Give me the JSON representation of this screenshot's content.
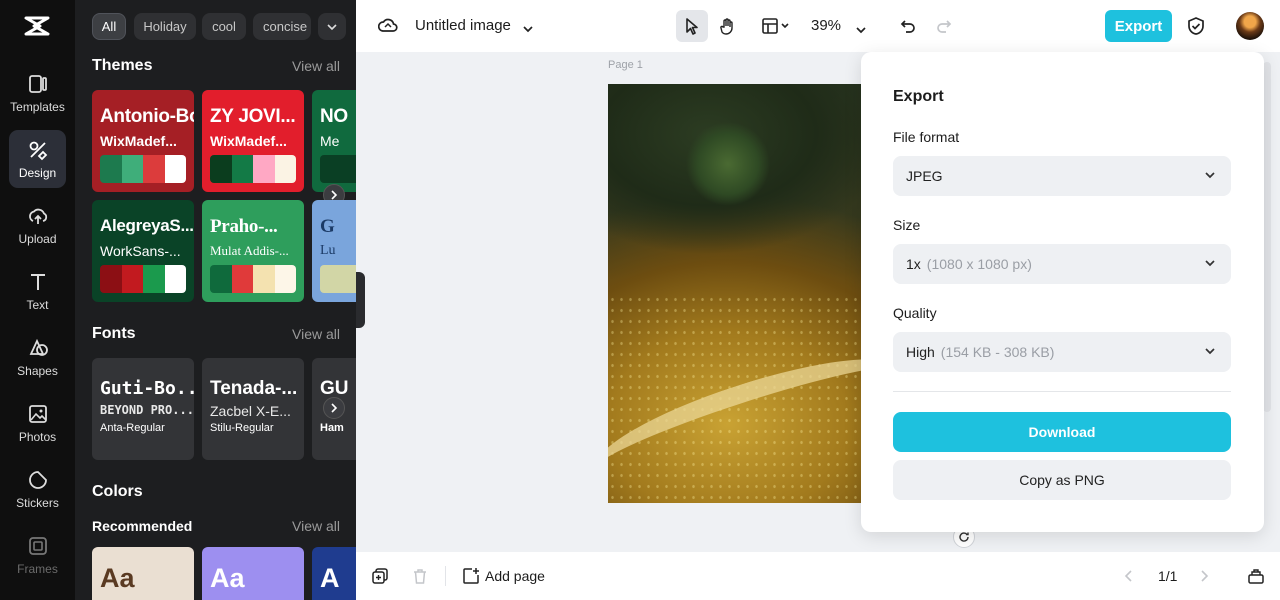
{
  "rail": {
    "items": [
      {
        "label": "Templates",
        "icon": "templates-icon"
      },
      {
        "label": "Design",
        "icon": "design-icon"
      },
      {
        "label": "Upload",
        "icon": "upload-icon"
      },
      {
        "label": "Text",
        "icon": "text-icon"
      },
      {
        "label": "Shapes",
        "icon": "shapes-icon"
      },
      {
        "label": "Photos",
        "icon": "photos-icon"
      },
      {
        "label": "Stickers",
        "icon": "stickers-icon"
      },
      {
        "label": "Frames",
        "icon": "frames-icon"
      }
    ]
  },
  "panel": {
    "chips": [
      "All",
      "Holiday",
      "cool",
      "concise"
    ],
    "themes": {
      "title": "Themes",
      "view_all": "View all",
      "cards": [
        {
          "font1": "Antonio-Bold",
          "font2": "WixMadef..."
        },
        {
          "font1": "ZY JOVI...",
          "font2": "WixMadef..."
        },
        {
          "font1": "NO",
          "font2": "Me"
        },
        {
          "font1": "AlegreyaS...",
          "font2": "WorkSans-..."
        },
        {
          "font1": "Praho-...",
          "font2": "Mulat Addis-..."
        },
        {
          "font1": "G",
          "font2": "Lu"
        }
      ]
    },
    "fonts": {
      "title": "Fonts",
      "view_all": "View all",
      "cards": [
        {
          "line1": "Guti-Bo...",
          "line2": "BEYOND PRO...",
          "line3": "Anta-Regular"
        },
        {
          "line1": "Tenada-...",
          "line2": "Zacbel X-E...",
          "line3": "Stilu-Regular"
        },
        {
          "line1": "GU",
          "line2": "",
          "line3": "Ham"
        }
      ]
    },
    "colors": {
      "title": "Colors",
      "subtitle": "Recommended",
      "view_all": "View all",
      "cards": [
        {
          "text": "Aa"
        },
        {
          "text": "Aa"
        },
        {
          "text": "A"
        }
      ]
    }
  },
  "topbar": {
    "doc_title": "Untitled image",
    "zoom": "39%",
    "export_label": "Export"
  },
  "canvas": {
    "page_label": "Page 1"
  },
  "export_panel": {
    "title": "Export",
    "file_format_label": "File format",
    "file_format_value": "JPEG",
    "size_label": "Size",
    "size_value": "1x",
    "size_detail": "(1080 x 1080 px)",
    "quality_label": "Quality",
    "quality_value": "High",
    "quality_detail": "(154 KB - 308 KB)",
    "download_label": "Download",
    "copy_label": "Copy as PNG"
  },
  "bottombar": {
    "add_page_label": "Add page",
    "page_counter": "1/1"
  },
  "colors": {
    "accent": "#1ec1de",
    "rail_bg": "#0f0f0f",
    "panel_bg": "#1d1e20"
  }
}
